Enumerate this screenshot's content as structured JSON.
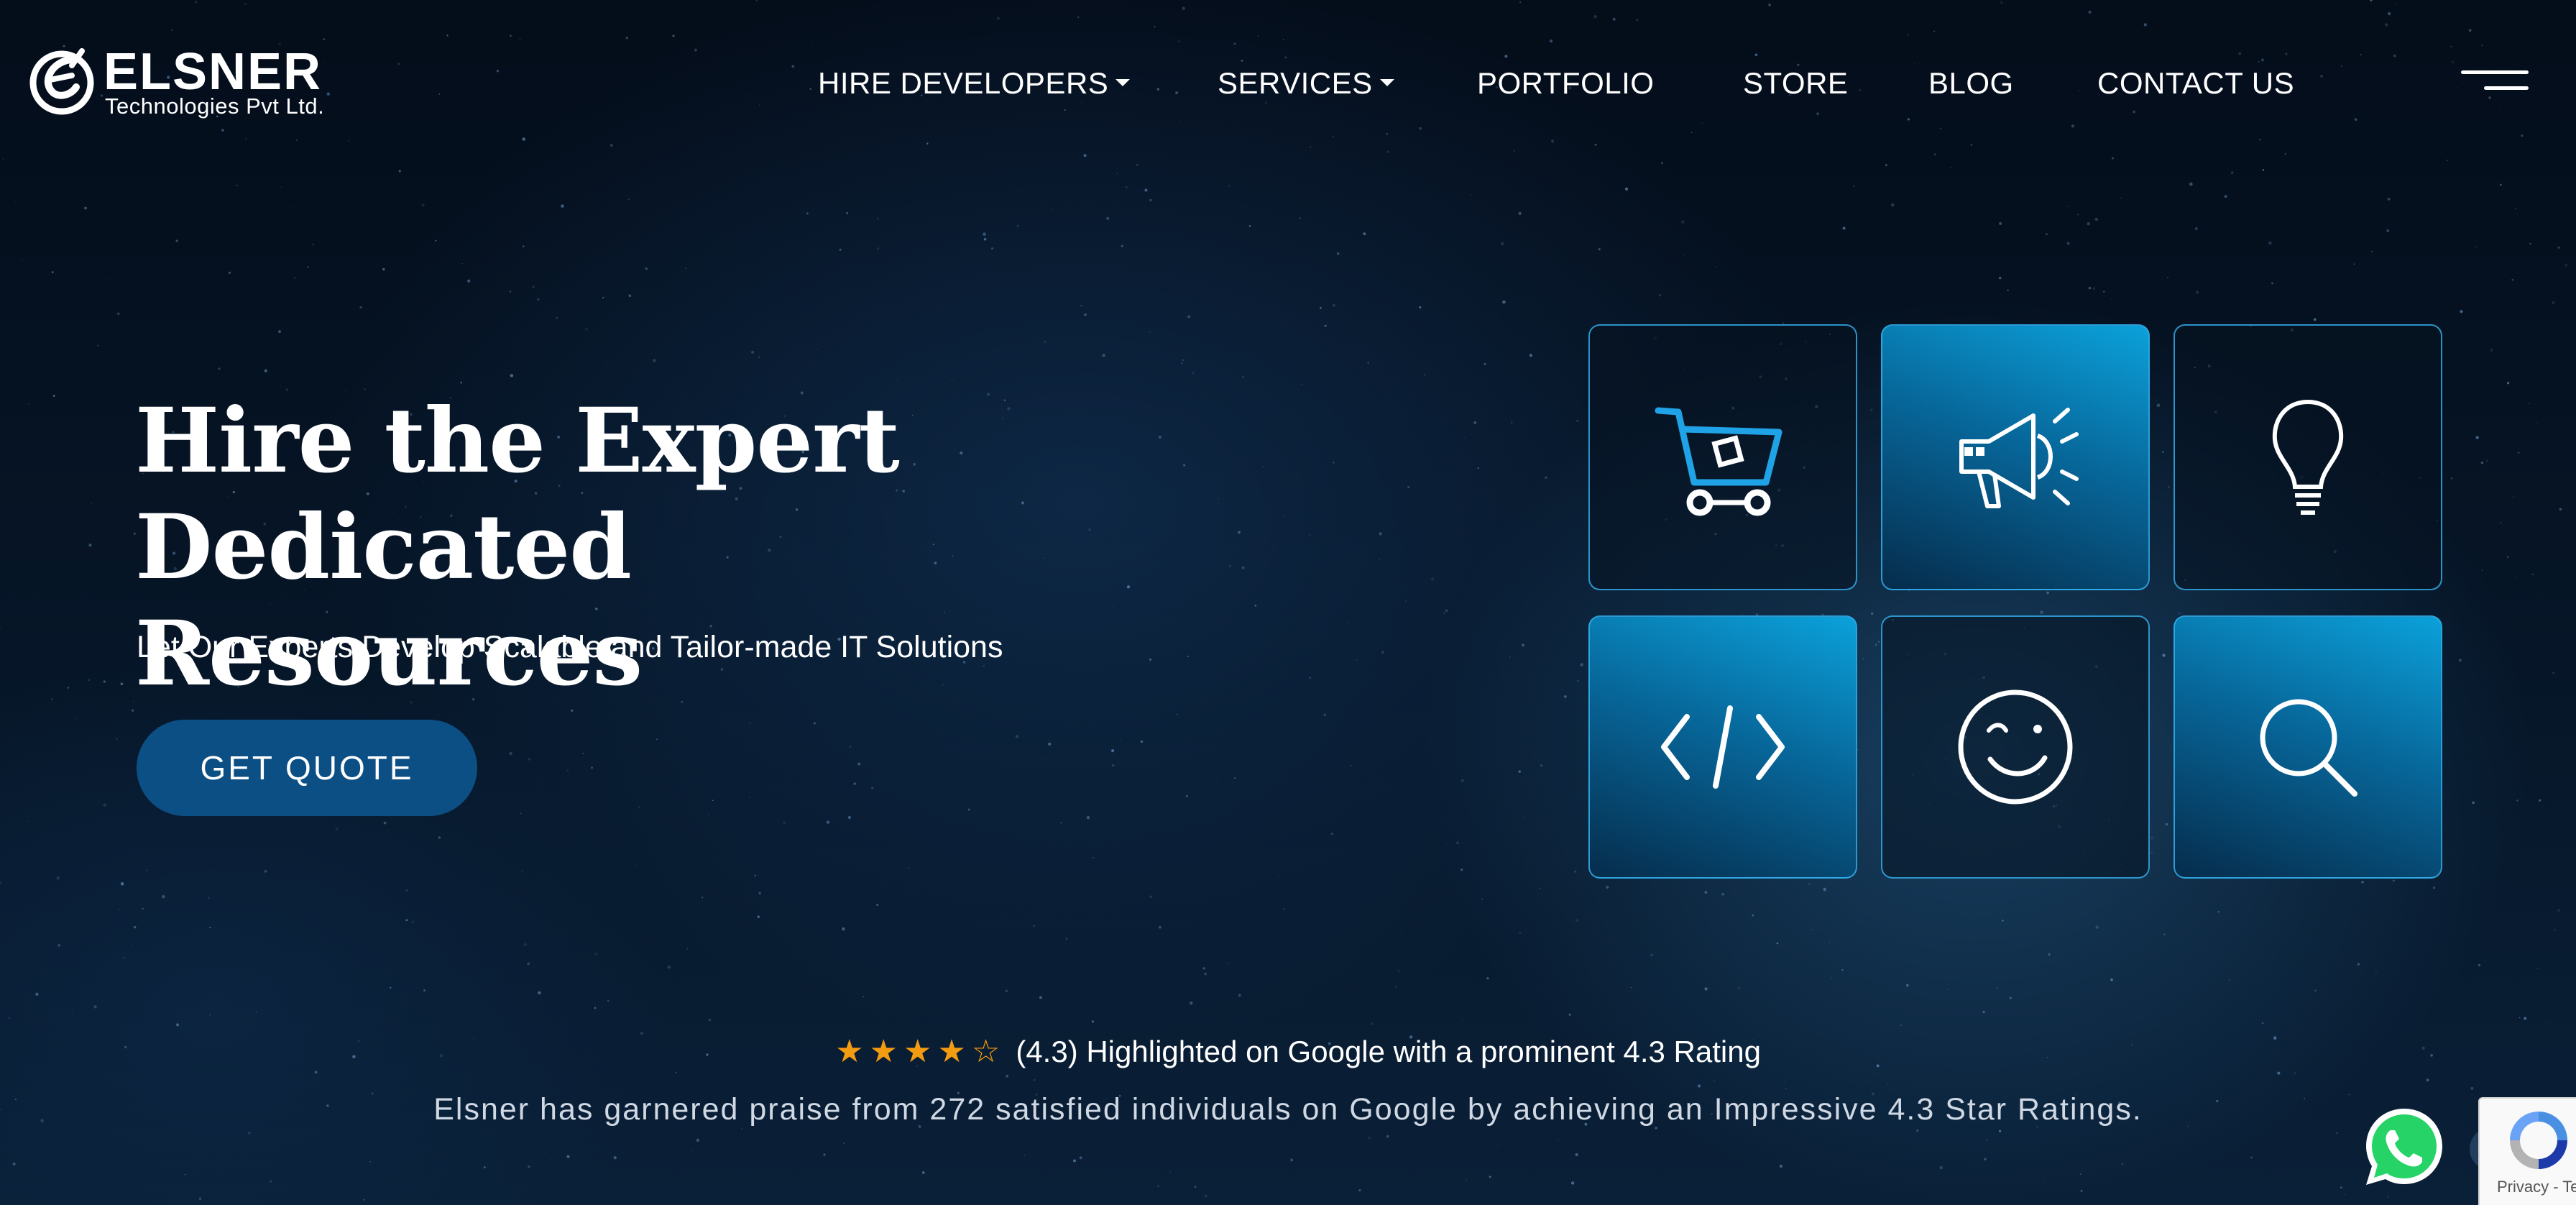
{
  "brand": {
    "name": "ELSNER",
    "tagline": "Technologies Pvt Ltd."
  },
  "nav": {
    "items": [
      {
        "label": "HIRE DEVELOPERS",
        "dropdown": true
      },
      {
        "label": "SERVICES",
        "dropdown": true
      },
      {
        "label": "PORTFOLIO",
        "dropdown": false
      },
      {
        "label": "STORE",
        "dropdown": false
      },
      {
        "label": "BLOG",
        "dropdown": false
      },
      {
        "label": "CONTACT US",
        "dropdown": false
      }
    ],
    "menu_icon": "hamburger-icon"
  },
  "hero": {
    "title_line1": "Hire the Expert Dedicated",
    "title_line2": "Resources",
    "subtitle": "Let Our Experts Develop Scalable and Tailor-made IT Solutions",
    "cta_label": "GET QUOTE"
  },
  "tiles": [
    {
      "icon": "shopping-cart-icon",
      "style": "dark"
    },
    {
      "icon": "megaphone-icon",
      "style": "lit"
    },
    {
      "icon": "lightbulb-icon",
      "style": "dark"
    },
    {
      "icon": "code-icon",
      "style": "lit"
    },
    {
      "icon": "smiley-icon",
      "style": "dark"
    },
    {
      "icon": "search-icon",
      "style": "lit"
    }
  ],
  "rating": {
    "value": 4.3,
    "max": 5,
    "filled_stars": 4,
    "headline": "(4.3) Highlighted on Google with a prominent 4.3 Rating",
    "description": "Elsner has garnered praise from 272 satisfied individuals on Google by achieving an Impressive 4.3 Star Ratings."
  },
  "widgets": {
    "whatsapp_icon": "whatsapp-icon",
    "recaptcha_text": "Privacy - Terms"
  },
  "colors": {
    "accent": "#0c4f84",
    "tile_border": "#34aae6",
    "star": "#f39c12",
    "whatsapp": "#25d366"
  }
}
